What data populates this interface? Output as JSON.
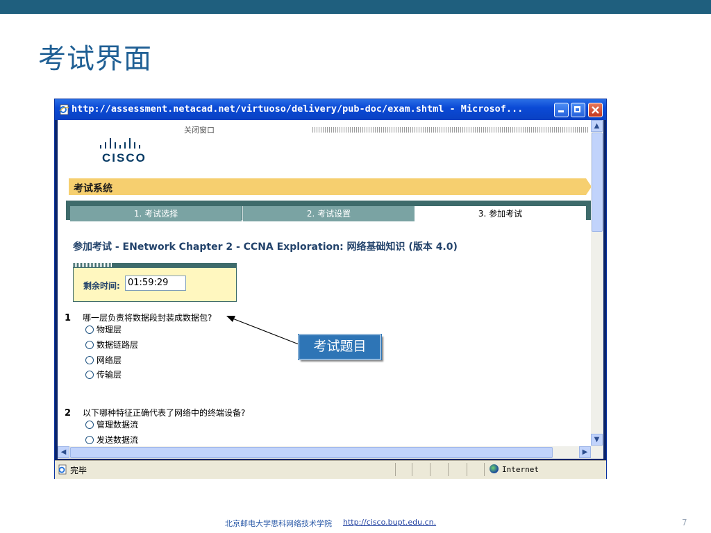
{
  "slide": {
    "title": "考试界面",
    "page_number": "7"
  },
  "browser": {
    "window_title": "http://assessment.netacad.net/virtuoso/delivery/pub-doc/exam.shtml - Microsof...",
    "status_text": "完毕",
    "zone_text": "Internet"
  },
  "page": {
    "close_window": "关闭窗口",
    "logo_text": "CISCO",
    "system_title": "考试系统",
    "tabs": [
      {
        "label": "1. 考试选择",
        "active": false
      },
      {
        "label": "2. 考试设置",
        "active": false
      },
      {
        "label": "3. 参加考试",
        "active": true
      }
    ],
    "exam_heading": "参加考试  - ENetwork Chapter 2 - CCNA Exploration: 网络基础知识  (版本  4.0)",
    "timer": {
      "label": "剩余时间:",
      "value": "01:59:29"
    },
    "questions": [
      {
        "number": "1",
        "text": "哪一层负责将数据段封装成数据包?",
        "options": [
          "物理层",
          "数据链路层",
          "网络层",
          "传输层"
        ]
      },
      {
        "number": "2",
        "text": "以下哪种特征正确代表了网络中的终端设备?",
        "options": [
          "管理数据流",
          "发送数据流"
        ]
      }
    ]
  },
  "annotation": {
    "label": "考试题目"
  },
  "footer": {
    "org": "北京邮电大学思科网络技术学院",
    "url": "http://cisco.bupt.edu.cn."
  },
  "colors": {
    "top_bar": "#1f5f7e",
    "title": "#1f5f94",
    "accent_band": "#f6cf6f",
    "tab_bg": "#7aa3a3",
    "callout": "#2e75b6"
  }
}
